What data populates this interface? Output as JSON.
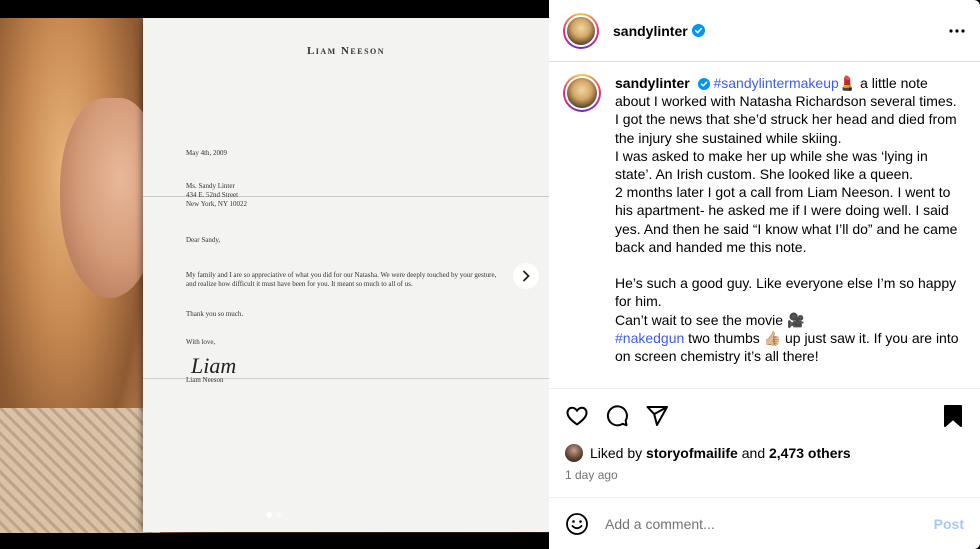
{
  "post": {
    "username": "sandylinter",
    "more_label": "More options",
    "letter": {
      "heading": "Liam Neeson",
      "date": "May 4th, 2009",
      "address": [
        "Ms. Sandy Linter",
        "434 E. 52nd Street",
        "New York, NY 10022"
      ],
      "salutation": "Dear Sandy,",
      "body": "My family and I are so appreciative of what you did for our Natasha.  We were deeply touched by your gesture, and realize how difficult it must have been for you.  It meant so much to all of us.",
      "thanks": "Thank you so much.",
      "closing": "With love,",
      "signature": "Liam",
      "signer": "Liam Neeson"
    },
    "caption": {
      "username": "sandylinter",
      "hashtag1": "#sandylintermakeup",
      "emoji1": "💄",
      "text1": " a little note about I worked with Natasha Richardson several times. I got the news that she’d struck her head and died from the injury she sustained while skiing.\nI was asked to make her up while she was ‘lying in state’. An Irish custom. She looked like a queen.\n2 months later I got a call from Liam Neeson. I went to his apartment- he asked me if I were doing well. I said yes. And then he said “I know what I’ll do” and he came back and handed me this note.\n\nHe’s such a good guy. Like everyone else I’m so happy for him.\nCan’t wait to see the movie 🎥\n",
      "hashtag2": "#nakedgun",
      "text2": " two thumbs 👍🏼 up just saw it. If you are into on screen chemistry it’s all there!"
    },
    "likes": {
      "prefix": "Liked by",
      "user": "storyofmailife",
      "and": "and",
      "count": "2,473 others"
    },
    "time": "1 day ago",
    "comment_placeholder": "Add a comment...",
    "post_label": "Post"
  },
  "colors": {
    "accent": "#3d5afe",
    "verified": "#0095f6",
    "post_disabled": "#a7c8f5"
  }
}
